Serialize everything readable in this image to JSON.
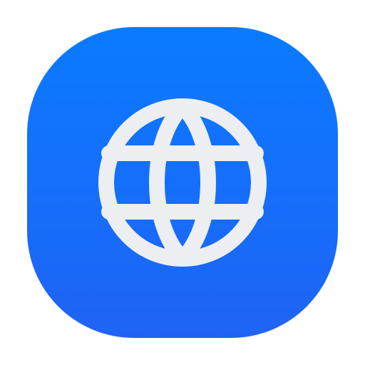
{
  "app_icon": {
    "name": "globe-app-icon",
    "icon": "globe-icon",
    "background_colors": [
      "#0a7bff",
      "#1f63f5"
    ],
    "glyph_color": "#eceef2"
  }
}
